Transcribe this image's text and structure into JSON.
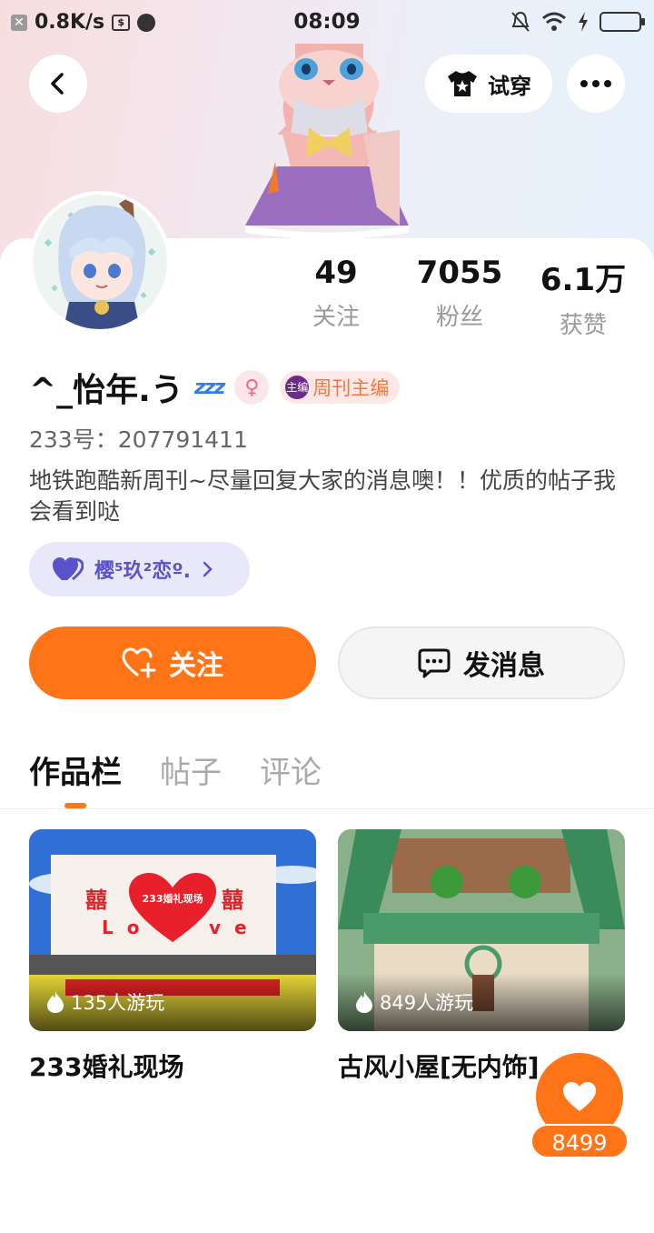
{
  "status_bar": {
    "net_speed": "0.8K/s",
    "time": "08:09"
  },
  "header": {
    "tryon_label": "试穿"
  },
  "profile": {
    "username": "^_怡年.う",
    "zzz": "zzz",
    "title_badge": "周刊主编",
    "title_badge_icon_text": "主编",
    "uid": "233号：207791411",
    "bio": "地铁跑酷新周刊~尽量回复大家的消息噢！！优质的帖子我会看到哒",
    "family_name": "樱⁵玖²恋º."
  },
  "stats": [
    {
      "num": "49",
      "label": "关注"
    },
    {
      "num": "7055",
      "label": "粉丝"
    },
    {
      "num": "6.1万",
      "label": "获赞"
    }
  ],
  "actions": {
    "follow_label": "关注",
    "message_label": "发消息"
  },
  "tabs": [
    {
      "label": "作品栏",
      "active": true
    },
    {
      "label": "帖子",
      "active": false
    },
    {
      "label": "评论",
      "active": false
    }
  ],
  "works": [
    {
      "title": "233婚礼现场",
      "plays": "135人游玩",
      "thumb_sign": "233婚礼现场",
      "thumb_xi": "囍",
      "thumb_love_l": "L o",
      "thumb_love_r": "v e"
    },
    {
      "title": "古风小屋[无内饰]",
      "plays": "849人游玩"
    }
  ],
  "like_fab": {
    "count": "8499"
  },
  "colors": {
    "accent": "#ff7417",
    "family_pill": "#e9e8fb",
    "family_text": "#5a52c8"
  }
}
